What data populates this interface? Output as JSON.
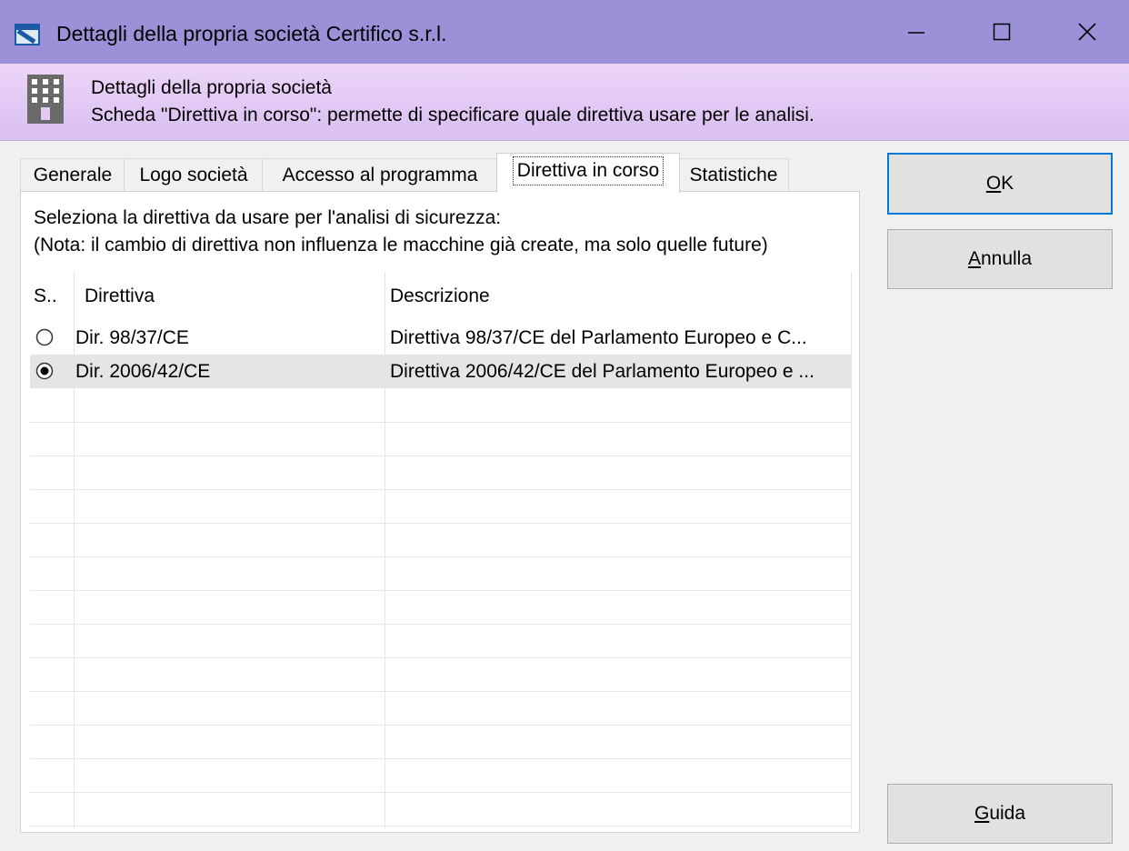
{
  "window": {
    "title": "Dettagli della propria società Certifico s.r.l.",
    "controls": [
      "minimize",
      "maximize",
      "close"
    ]
  },
  "banner": {
    "icon": "building-icon",
    "title": "Dettagli della propria società",
    "subtitle": "Scheda \"Direttiva in corso\": permette di specificare quale direttiva usare per le analisi."
  },
  "tabs": [
    {
      "label": "Generale",
      "active": false
    },
    {
      "label": "Logo società",
      "active": false
    },
    {
      "label": "Accesso al programma",
      "active": false
    },
    {
      "label": "Direttiva in corso",
      "active": true
    },
    {
      "label": "Statistiche",
      "active": false
    }
  ],
  "panel": {
    "instruction": "Seleziona la direttiva da usare per l'analisi di sicurezza:",
    "note": "(Nota: il cambio di direttiva non influenza le macchine già create, ma solo quelle future)"
  },
  "list": {
    "columns": [
      "S..",
      "Direttiva",
      "Descrizione"
    ],
    "rows": [
      {
        "selected": false,
        "directive": "Dir. 98/37/CE",
        "description": "Direttiva 98/37/CE del Parlamento Europeo e C..."
      },
      {
        "selected": true,
        "directive": "Dir. 2006/42/CE",
        "description": "Direttiva 2006/42/CE del Parlamento Europeo e ..."
      }
    ]
  },
  "buttons": {
    "ok": {
      "mnemonic": "O",
      "rest": "K"
    },
    "cancel": {
      "mnemonic": "A",
      "rest": "nnulla"
    },
    "help": {
      "mnemonic": "G",
      "rest": "uida"
    }
  },
  "colors": {
    "titlebar": "#9a91d8",
    "banner": "#e2caf4",
    "default_button_border": "#0078d7"
  }
}
